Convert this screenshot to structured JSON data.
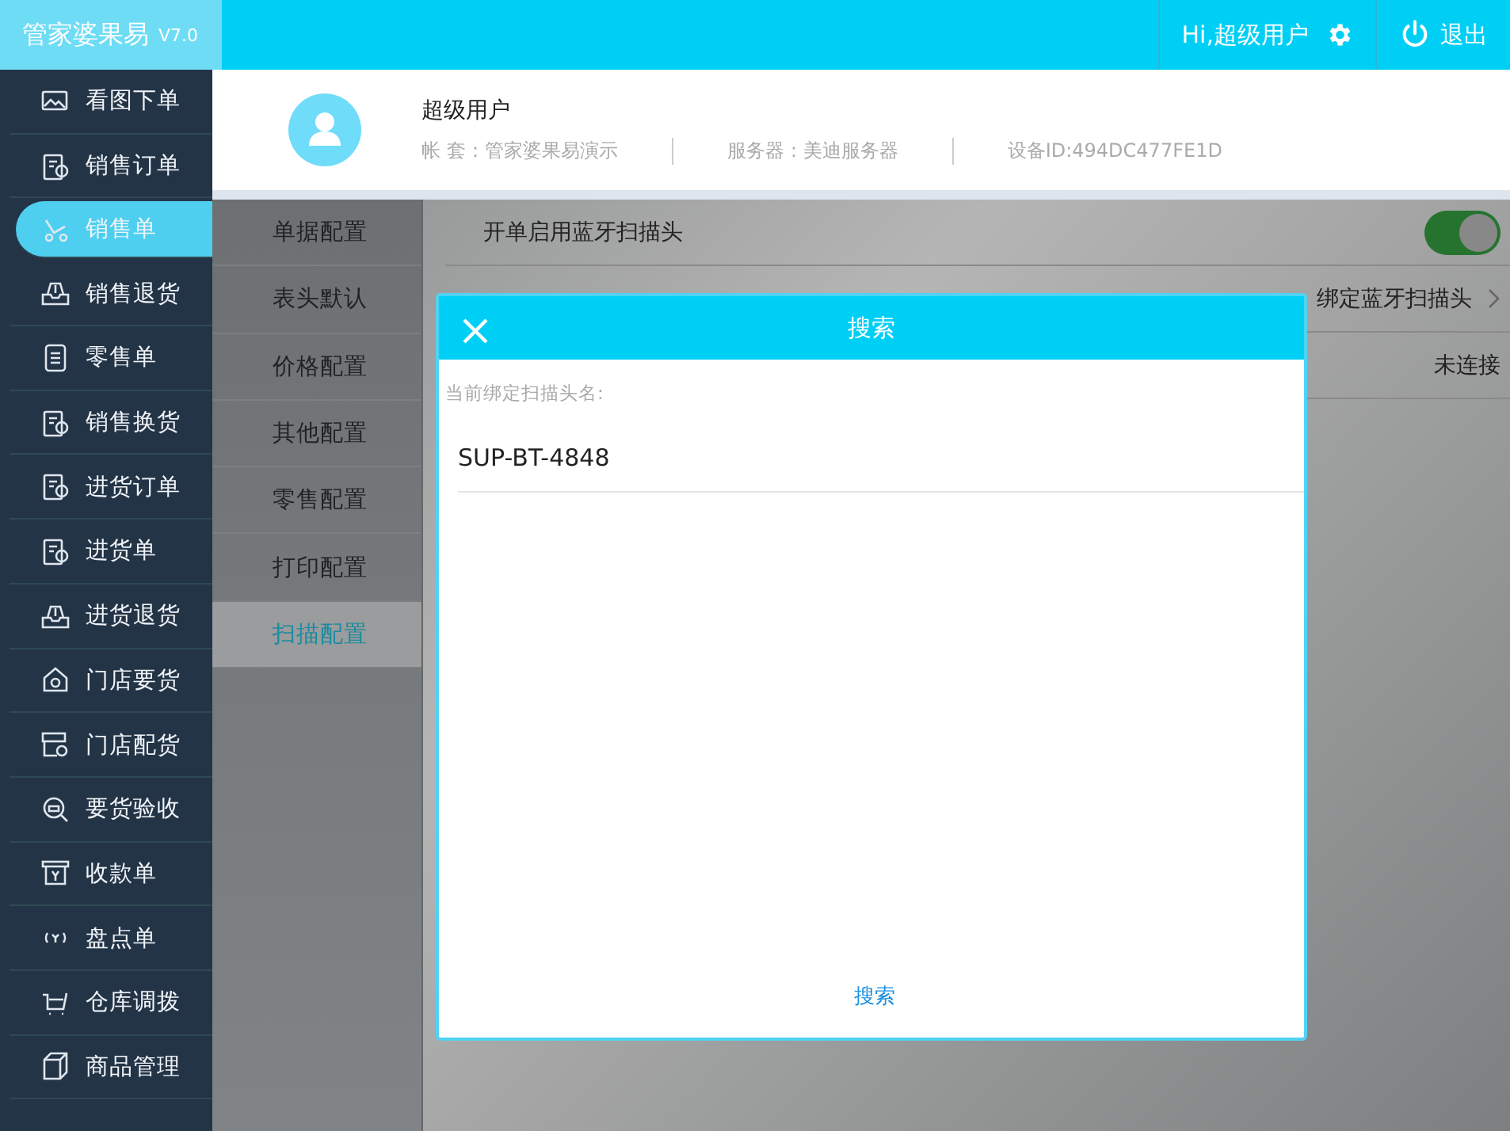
{
  "app": {
    "name": "管家婆果易",
    "version": "V7.0"
  },
  "topbar": {
    "greeting": "Hi,超级用户",
    "logout": "退出"
  },
  "sidebar": {
    "items": [
      {
        "label": "看图下单",
        "selected": false
      },
      {
        "label": "销售订单",
        "selected": false
      },
      {
        "label": "销售单",
        "selected": true
      },
      {
        "label": "销售退货",
        "selected": false
      },
      {
        "label": "零售单",
        "selected": false
      },
      {
        "label": "销售换货",
        "selected": false
      },
      {
        "label": "进货订单",
        "selected": false
      },
      {
        "label": "进货单",
        "selected": false
      },
      {
        "label": "进货退货",
        "selected": false
      },
      {
        "label": "门店要货",
        "selected": false
      },
      {
        "label": "门店配货",
        "selected": false
      },
      {
        "label": "要货验收",
        "selected": false
      },
      {
        "label": "收款单",
        "selected": false
      },
      {
        "label": "盘点单",
        "selected": false
      },
      {
        "label": "仓库调拨",
        "selected": false
      },
      {
        "label": "商品管理",
        "selected": false
      }
    ]
  },
  "profile": {
    "name": "超级用户",
    "account": "帐  套：管家婆果易演示",
    "server": "服务器：美迪服务器",
    "device": "设备ID:494DC477FE1D"
  },
  "settings_menu": {
    "items": [
      {
        "label": "单据配置",
        "selected": false
      },
      {
        "label": "表头默认",
        "selected": false
      },
      {
        "label": "价格配置",
        "selected": false
      },
      {
        "label": "其他配置",
        "selected": false
      },
      {
        "label": "零售配置",
        "selected": false
      },
      {
        "label": "打印配置",
        "selected": false
      },
      {
        "label": "扫描配置",
        "selected": true
      }
    ]
  },
  "settings_rows": [
    {
      "kind": "toggle",
      "label": "开单启用蓝牙扫描头",
      "on": true
    },
    {
      "kind": "link",
      "value": "绑定蓝牙扫描头"
    },
    {
      "kind": "status",
      "value": "未连接"
    }
  ],
  "dialog": {
    "title": "搜索",
    "field_label": "当前绑定扫描头名:",
    "value": "SUP-BT-4848",
    "action": "搜索"
  }
}
